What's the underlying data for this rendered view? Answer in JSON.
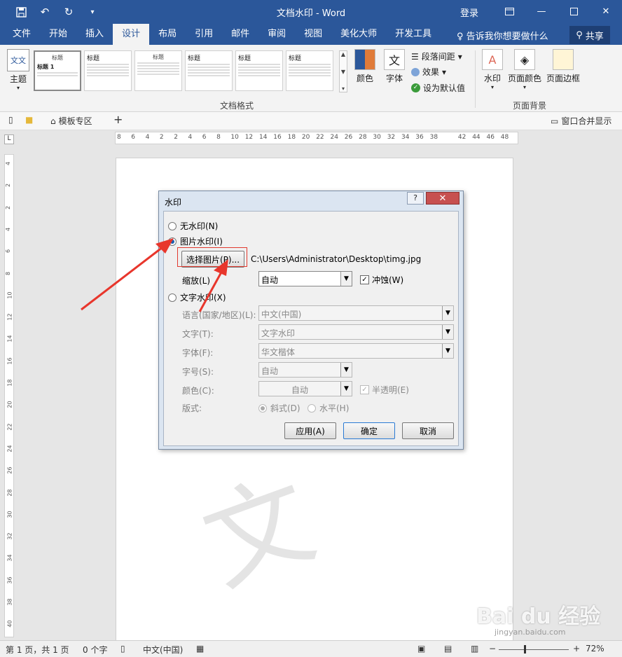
{
  "titlebar": {
    "title": "文档水印 - Word",
    "login": "登录"
  },
  "tabs": [
    "文件",
    "开始",
    "插入",
    "设计",
    "布局",
    "引用",
    "邮件",
    "审阅",
    "视图",
    "美化大师",
    "开发工具"
  ],
  "tell_me": "告诉我你想要做什么",
  "share": "共享",
  "ribbon": {
    "theme": "主题",
    "gallery_titles": [
      "标题",
      "标题",
      "标题",
      "标题",
      "标题",
      "标题"
    ],
    "gallery_heading": "标题 1",
    "colors": "颜色",
    "fonts": "字体",
    "para_spacing": "段落间距",
    "effects": "效果",
    "set_default": "设为默认值",
    "group_doc_format": "文档格式",
    "watermark": "水印",
    "page_color": "页面颜色",
    "page_border": "页面边框",
    "group_page_bg": "页面背景"
  },
  "docbar": {
    "template": "模板专区",
    "window_merge": "窗口合并显示"
  },
  "hruler": [
    "8",
    "6",
    "4",
    "2",
    "2",
    "4",
    "6",
    "8",
    "10",
    "12",
    "14",
    "16",
    "18",
    "20",
    "22",
    "24",
    "26",
    "28",
    "30",
    "32",
    "34",
    "36",
    "38",
    "42",
    "44",
    "46",
    "48"
  ],
  "vruler": [
    "4",
    "2",
    "2",
    "4",
    "6",
    "8",
    "10",
    "12",
    "14",
    "16",
    "18",
    "20",
    "22",
    "24",
    "26",
    "28",
    "30",
    "32",
    "34",
    "36",
    "38",
    "40"
  ],
  "watermark_glyph": "文",
  "dialog": {
    "title": "水印",
    "help": "?",
    "close": "✕",
    "no_watermark": "无水印(N)",
    "picture_watermark": "图片水印(I)",
    "select_picture": "选择图片(P)...",
    "picture_path": "C:\\Users\\Administrator\\Desktop\\timg.jpg",
    "scale_label": "缩放(L)",
    "scale_value": "自动",
    "washout": "冲蚀(W)",
    "text_watermark": "文字水印(X)",
    "language_label": "语言(国家/地区)(L):",
    "language_value": "中文(中国)",
    "text_label": "文字(T):",
    "text_value": "文字水印",
    "font_label": "字体(F):",
    "font_value": "华文楷体",
    "size_label": "字号(S):",
    "size_value": "自动",
    "color_label": "颜色(C):",
    "color_value": "自动",
    "semitransparent": "半透明(E)",
    "layout_label": "版式:",
    "diagonal": "斜式(D)",
    "horizontal": "水平(H)",
    "apply": "应用(A)",
    "ok": "确定",
    "cancel": "取消"
  },
  "status": {
    "page": "第 1 页，共 1 页",
    "words": "0 个字",
    "lang": "中文(中国)",
    "zoom": "72%"
  },
  "baidu_logo": "Bai du 经验",
  "baidu_url": "jingyan.baidu.com"
}
